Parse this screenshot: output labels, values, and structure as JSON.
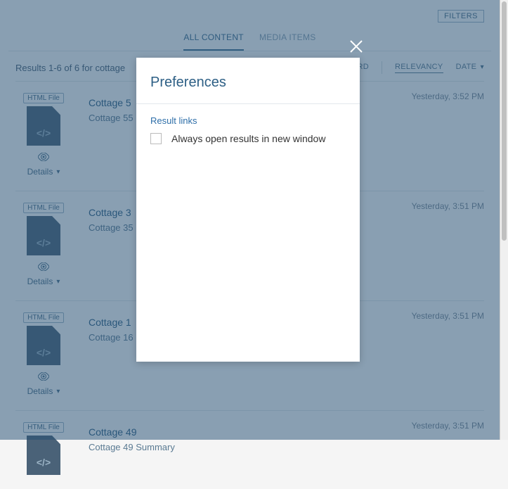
{
  "header": {
    "filters_label": "FILTERS",
    "tabs": {
      "all_content": "ALL CONTENT",
      "media_items": "MEDIA ITEMS"
    }
  },
  "subheader": {
    "results_text": "Results 1-6 of 6 for cottage",
    "card_label": "CARD",
    "relevancy_label": "RELEVANCY",
    "date_label": "DATE"
  },
  "badge_label": "HTML File",
  "details_label": "Details",
  "results": [
    {
      "title": "Cottage 5",
      "sub": "Cottage 55",
      "time": "Yesterday, 3:52 PM"
    },
    {
      "title": "Cottage 3",
      "sub": "Cottage 35",
      "time": "Yesterday, 3:51 PM"
    },
    {
      "title": "Cottage 1",
      "sub": "Cottage 16",
      "time": "Yesterday, 3:51 PM"
    },
    {
      "title": "Cottage 49",
      "sub": "Cottage 49 Summary",
      "time": "Yesterday, 3:51 PM"
    }
  ],
  "modal": {
    "title": "Preferences",
    "section_label": "Result links",
    "checkbox_label": "Always open results in new window"
  }
}
